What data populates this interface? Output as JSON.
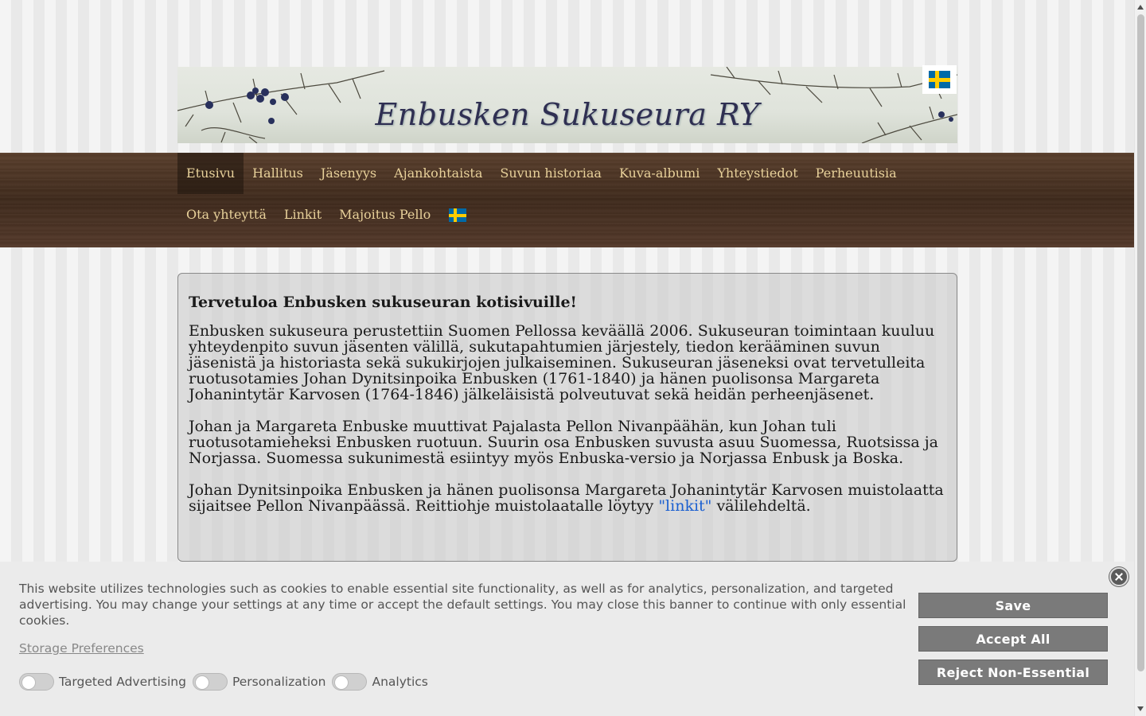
{
  "header": {
    "title": "Enbusken Sukuseura RY",
    "flag_icon": "swedish-flag-icon"
  },
  "nav": {
    "items": [
      {
        "label": "Etusivu",
        "active": true
      },
      {
        "label": "Hallitus"
      },
      {
        "label": "Jäsenyys"
      },
      {
        "label": "Ajankohtaista"
      },
      {
        "label": "Suvun historiaa"
      },
      {
        "label": "Kuva-albumi"
      },
      {
        "label": "Yhteystiedot"
      },
      {
        "label": "Perheuutisia"
      },
      {
        "label": "Ota yhteyttä"
      },
      {
        "label": "Linkit"
      },
      {
        "label": "Majoitus Pello"
      }
    ],
    "flag_icon": "swedish-flag-icon"
  },
  "content": {
    "heading": "Tervetuloa Enbusken sukuseuran kotisivuille!",
    "p1": "Enbusken sukuseura perustettiin Suomen Pellossa keväällä 2006. Sukuseuran toimintaan kuuluu yhteydenpito suvun jäsenten välillä, sukutapahtumien järjestely, tiedon kerääminen suvun jäsenistä ja historiasta sekä sukukirjojen julkaiseminen. Sukuseuran jäseneksi ovat tervetulleita ruotusotamies Johan Dynitsinpoika Enbusken (1761-1840) ja hänen puolisonsa Margareta Johanintytär Karvosen (1764-1846) jälkeläisistä polveutuvat sekä heidän perheenjäsenet.",
    "p2": "Johan ja Margareta Enbuske muuttivat Pajalasta Pellon Nivanpäähän, kun Johan tuli ruotusotamieheksi Enbusken ruotuun. Suurin osa Enbusken suvusta asuu Suomessa, Ruotsissa ja Norjassa. Suomessa sukunimestä esiintyy myös Enbuska-versio ja Norjassa Enbusk ja Boska.",
    "p3_before": "Johan Dynitsinpoika Enbusken ja hänen puolisonsa Margareta Johanintytär Karvosen muistolaatta sijaitsee Pellon Nivanpäässä. Reittiohje muistolaatalle löytyy ",
    "p3_link": "\"linkit\"",
    "p3_after": " välilehdeltä."
  },
  "cookie": {
    "text": "This website utilizes technologies such as cookies to enable essential site functionality, as well as for analytics, personalization, and targeted advertising. You may change your settings at any time or accept the default settings. You may close this banner to continue with only essential cookies.",
    "preferences_link": "Storage Preferences",
    "toggles": [
      "Targeted Advertising",
      "Personalization",
      "Analytics"
    ],
    "save_label": "Save",
    "accept_label": "Accept All",
    "reject_label": "Reject Non-Essential"
  }
}
